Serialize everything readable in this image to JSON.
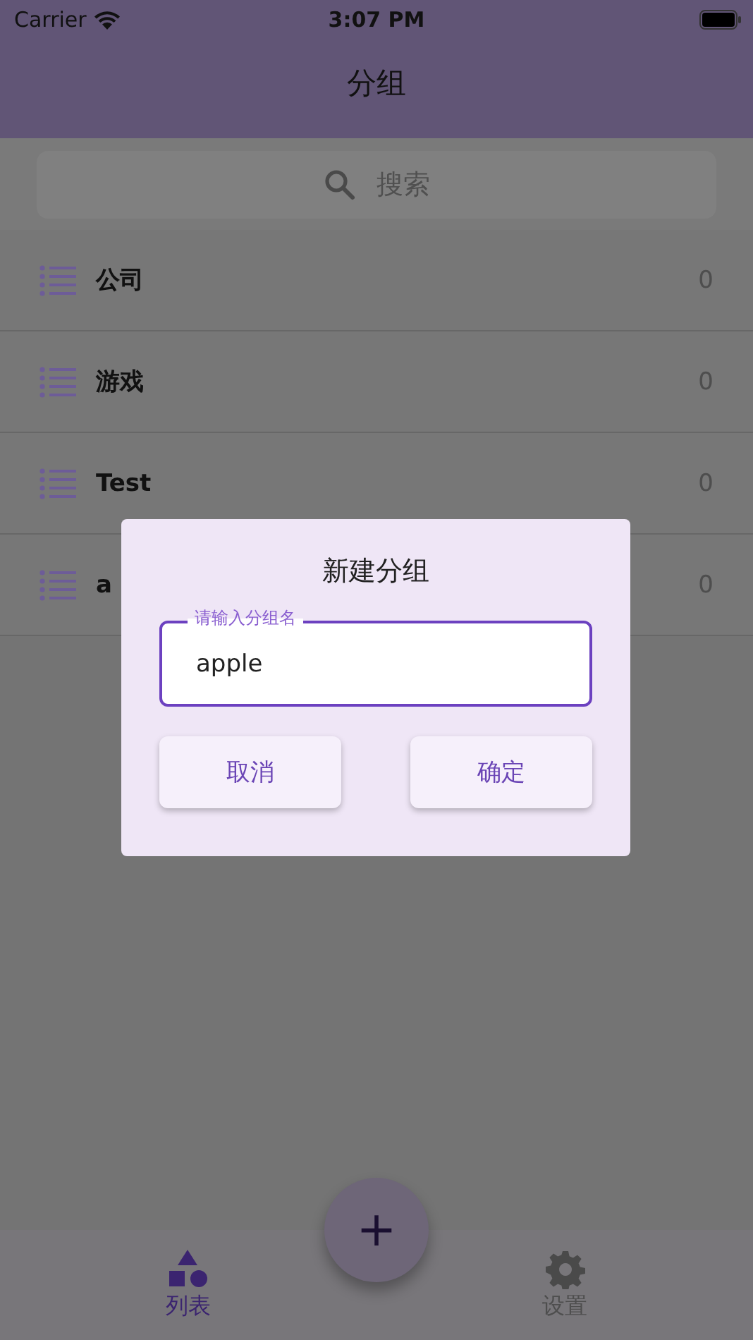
{
  "status_bar": {
    "carrier": "Carrier",
    "time": "3:07 PM"
  },
  "app_bar": {
    "title": "分组"
  },
  "search": {
    "placeholder": "搜索"
  },
  "groups": [
    {
      "name": "公司",
      "count": "0"
    },
    {
      "name": "游戏",
      "count": "0"
    },
    {
      "name": "Test",
      "count": "0"
    },
    {
      "name": "a",
      "count": "0"
    }
  ],
  "dialog": {
    "title": "新建分组",
    "field": {
      "label": "请输入分组名",
      "value": "apple"
    },
    "buttons": [
      "取消",
      "确定"
    ]
  },
  "fab": {
    "label": "+"
  },
  "tabs": [
    {
      "label": "列表",
      "kind": "shapes",
      "selected": true
    },
    {
      "label": "设置",
      "kind": "gear",
      "selected": false
    }
  ]
}
